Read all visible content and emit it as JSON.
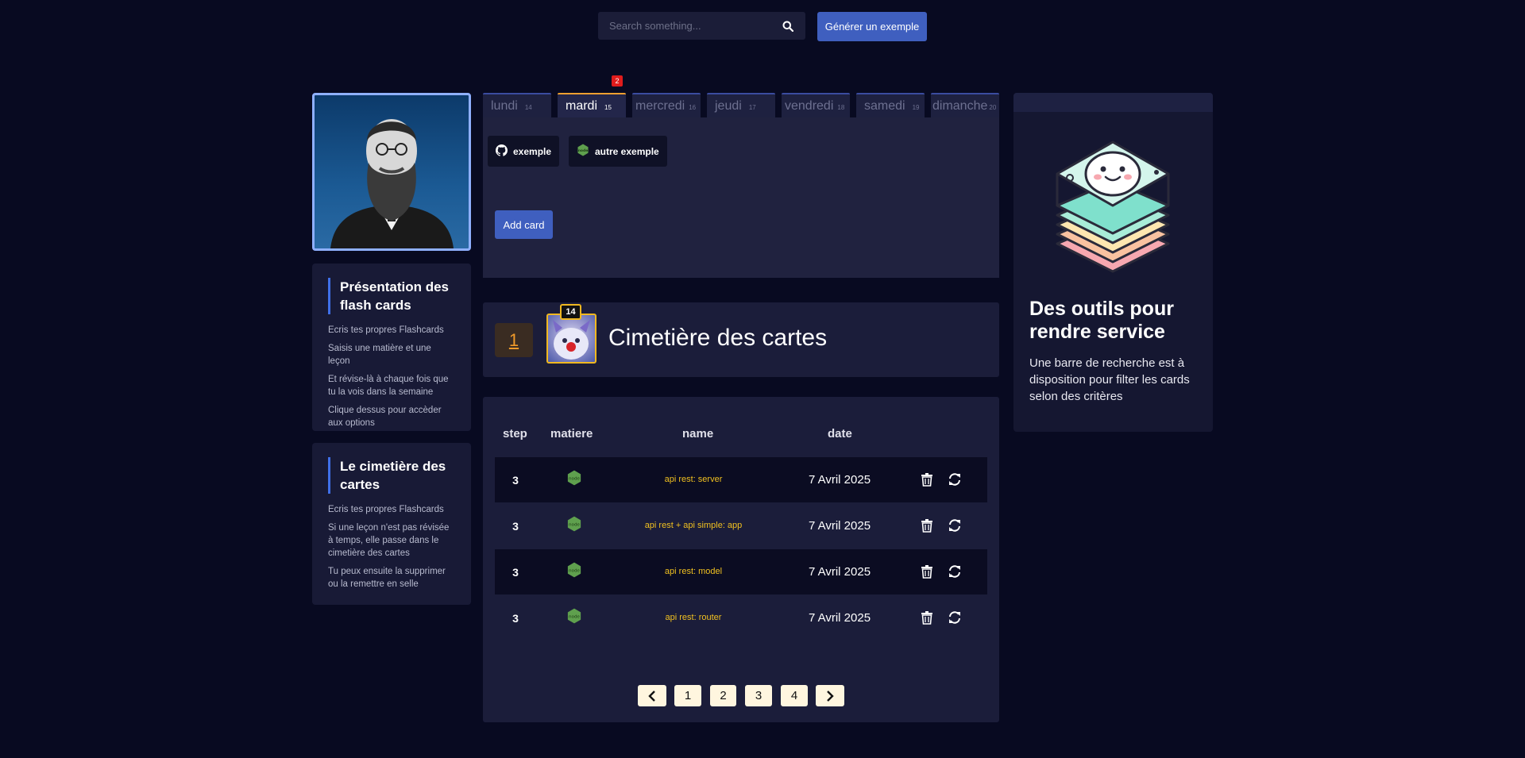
{
  "header": {
    "search_placeholder": "Search something...",
    "generate_label": "Générer un exemple"
  },
  "sidebar": {
    "cards": [
      {
        "title": "Présentation des flash cards",
        "lines": [
          "Ecris tes propres Flashcards",
          "Saisis une matière et une leçon",
          "Et révise-là à chaque fois que tu la vois dans la semaine",
          "Clique dessus pour accèder aux options"
        ]
      },
      {
        "title": "Le cimetière des cartes",
        "lines": [
          "Ecris tes propres Flashcards",
          "Si une leçon n'est pas révisée à temps, elle passe dans le cimetière des cartes",
          "Tu peux ensuite la supprimer ou la remettre en selle"
        ]
      }
    ]
  },
  "tabs": {
    "badge": "2",
    "items": [
      {
        "label": "lundi",
        "num": "14"
      },
      {
        "label": "mardi",
        "num": "15"
      },
      {
        "label": "mercredi",
        "num": "16"
      },
      {
        "label": "jeudi",
        "num": "17"
      },
      {
        "label": "vendredi",
        "num": "18"
      },
      {
        "label": "samedi",
        "num": "19"
      },
      {
        "label": "dimanche",
        "num": "20"
      }
    ],
    "active": "mardi",
    "chips": [
      "exemple",
      "autre exemple"
    ],
    "add_card_label": "Add card"
  },
  "graveyard": {
    "count": "1",
    "avatar_badge": "14",
    "title": "Cimetière des cartes"
  },
  "table": {
    "headers": {
      "step": "step",
      "matiere": "matiere",
      "name": "name",
      "date": "date"
    },
    "rows": [
      {
        "step": "3",
        "matiere_icon": "nodejs-icon",
        "name": "api rest: server",
        "date": "7 Avril 2025"
      },
      {
        "step": "3",
        "matiere_icon": "nodejs-icon",
        "name": "api rest + api simple: app",
        "date": "7 Avril 2025"
      },
      {
        "step": "3",
        "matiere_icon": "nodejs-icon",
        "name": "api rest: model",
        "date": "7 Avril 2025"
      },
      {
        "step": "3",
        "matiere_icon": "nodejs-icon",
        "name": "api rest: router",
        "date": "7 Avril 2025"
      }
    ],
    "pagination": {
      "prev": "‹",
      "pages": [
        "1",
        "2",
        "3",
        "4"
      ],
      "next": "›"
    }
  },
  "right_panel": {
    "title": "Des outils pour rendre service",
    "text": "Une barre de recherche est à disposition pour filter les cards selon des critères"
  },
  "colors": {
    "background": "#080a21",
    "accent_blue": "#3f5fbf",
    "active_tab": "#f0a030",
    "name_yellow": "#f0c020",
    "badge_red": "#e01c1c"
  }
}
